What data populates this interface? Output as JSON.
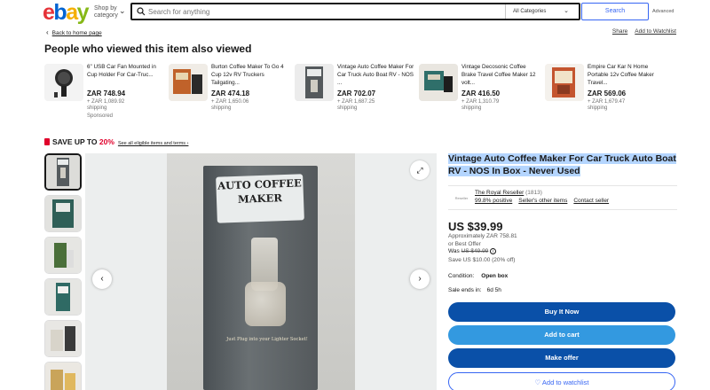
{
  "header": {
    "logo": {
      "e": "e",
      "b": "b",
      "a": "a",
      "y": "y"
    },
    "shop_by": "Shop by category",
    "search_placeholder": "Search for anything",
    "category": "All Categories",
    "search_button": "Search",
    "advanced": "Advanced"
  },
  "nav": {
    "back": "Back to home page",
    "share": "Share",
    "watchlist": "Add to Watchlist"
  },
  "also_viewed": {
    "title": "People who viewed this item also viewed",
    "items": [
      {
        "title": "6\" USB Car Fan Mounted in Cup Holder For Car-Truc...",
        "price": "ZAR 748.94",
        "old_price": "+ ZAR 1,089.92",
        "ship": "shipping",
        "sponsored": "Sponsored"
      },
      {
        "title": "Burton Coffee Maker To Go 4 Cup 12v RV Truckers Tailgating...",
        "price": "ZAR 474.18",
        "old_price": "+ ZAR 1,650.06",
        "ship": "shipping"
      },
      {
        "title": "Vintage Auto Coffee Maker For Car Truck Auto Boat RV - NOS ...",
        "price": "ZAR 702.07",
        "old_price": "+ ZAR 1,687.25",
        "ship": "shipping"
      },
      {
        "title": "Vintage Decosonic Coffee Brake Travel Coffee Maker 12 volt...",
        "price": "ZAR 416.50",
        "old_price": "+ ZAR 1,310.79",
        "ship": "shipping"
      },
      {
        "title": "Empire Car Kar N Home Portable 12v Coffee Maker Travel...",
        "price": "ZAR 569.06",
        "old_price": "+ ZAR 1,679.47",
        "ship": "shipping"
      }
    ]
  },
  "promo": {
    "prefix": "SAVE UP TO",
    "percent": "20%",
    "link": "See all eligible items and terms ›"
  },
  "product": {
    "box_title": "AUTO COFFEE MAKER",
    "box_caption": "Just Plug into your Lighter Socket!",
    "title": "Vintage Auto Coffee Maker For Car Truck Auto Boat RV - NOS In Box - Never Used",
    "seller_logo": "Reseller",
    "seller_name": "The Royal Reseller",
    "seller_count": "(1813)",
    "seller_positive": "99.8% positive",
    "seller_other": "Seller's other items",
    "contact": "Contact seller",
    "price": "US $39.99",
    "approx": "Approximately ZAR 758.81",
    "best_offer": "or Best Offer",
    "was_label": "Was",
    "was_price": "US $49.99",
    "save": "Save US $10.00 (20% off)",
    "condition_label": "Condition:",
    "condition": "Open box",
    "ends_label": "Sale ends in:",
    "ends": "6d 5h",
    "buy": "Buy It Now",
    "cart": "Add to cart",
    "offer": "Make offer",
    "watch": "♡ Add to watchlist"
  },
  "colors": {
    "buy": "#0a50a8",
    "cart": "#3399e0",
    "promo_red": "#e0002b",
    "accent": "#3665f3"
  }
}
